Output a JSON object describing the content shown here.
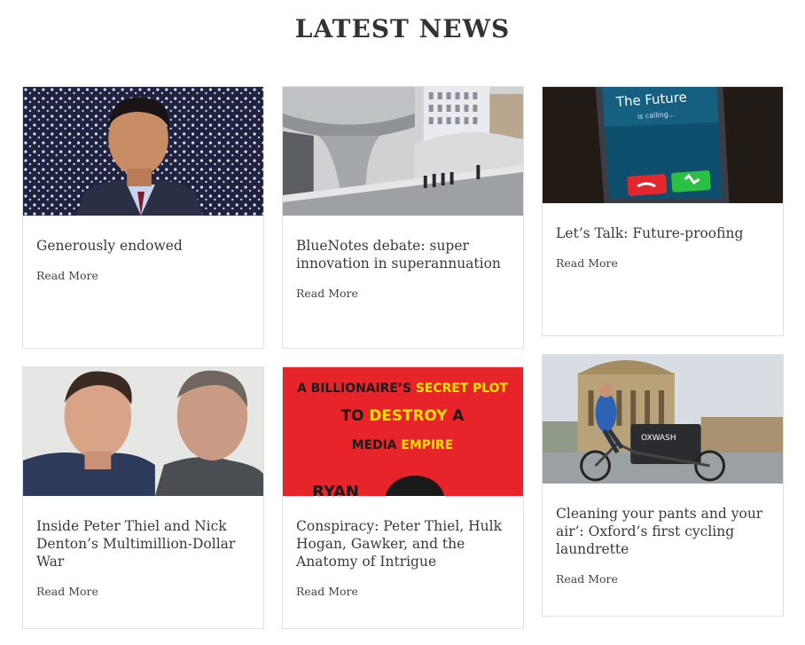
{
  "page": {
    "title": "LATEST NEWS"
  },
  "articles": [
    {
      "title": "Generously endowed",
      "read_more": "Read More",
      "image": "portrait-photo"
    },
    {
      "title": "BlueNotes debate: super innovation in superannuation",
      "read_more": "Read More",
      "image": "architecture-photo"
    },
    {
      "title": "Let’s Talk: Future-proofing",
      "read_more": "Read More",
      "image": "phone-photo",
      "image_text": {
        "caller": "The Future",
        "status": "is calling..."
      }
    },
    {
      "title": "Inside Peter Thiel and Nick Denton’s Multimillion-Dollar War",
      "read_more": "Read More",
      "image": "two-men-photo"
    },
    {
      "title": "Conspiracy: Peter Thiel, Hulk Hogan, Gawker, and the Anatomy of Intrigue",
      "read_more": "Read More",
      "image": "book-cover",
      "image_text": {
        "line1a": "A BILLIONAIRE’S ",
        "line1b": "SECRET PLOT",
        "line2a": "TO ",
        "line2b": "DESTROY",
        "line2c": " A",
        "line3a": "MEDIA ",
        "line3b": "EMPIRE",
        "line4": "RYAN"
      }
    },
    {
      "title": "Cleaning your pants and your air’: Oxford’s first cycling laundrette",
      "read_more": "Read More",
      "image": "cargo-bike-photo",
      "image_text": {
        "brand": "OXWASH"
      }
    }
  ],
  "colors": {
    "text": "#333333",
    "border": "#e0e0e0",
    "cover_red": "#e8242b",
    "highlight_yellow": "#f5e000"
  }
}
